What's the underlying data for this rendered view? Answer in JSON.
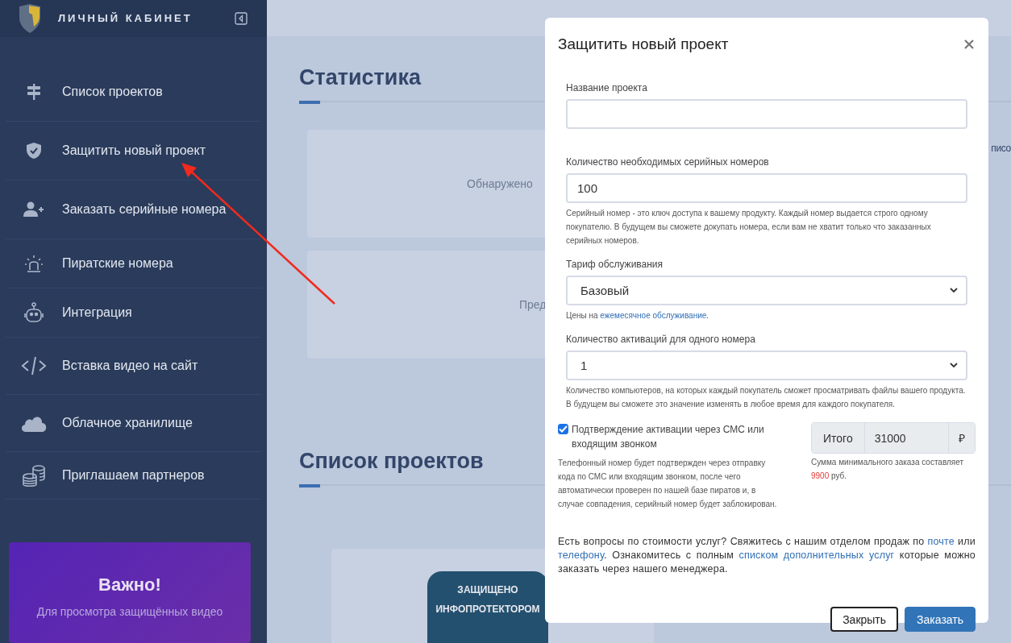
{
  "sidebar": {
    "brand": "ЛИЧНЫЙ КАБИНЕТ",
    "items": [
      {
        "label": "Список проектов"
      },
      {
        "label": "Защитить новый проект"
      },
      {
        "label": "Заказать серийные номера"
      },
      {
        "label": "Пиратские номера"
      },
      {
        "label": "Интеграция"
      },
      {
        "label": "Вставка видео на сайт"
      },
      {
        "label": "Облачное хранилище"
      },
      {
        "label": "Приглашаем партнеров"
      }
    ],
    "notice": {
      "title": "Важно!",
      "text": "Для просмотра защищённых видео"
    }
  },
  "page": {
    "stats_title": "Статистика",
    "stat_cards": [
      "Обнаружено",
      "Пред"
    ],
    "side_text": "писо",
    "projects_title": "Список проектов",
    "cover_text": [
      "ЗАЩИЩЕНО",
      "ИНФОПРОТЕКТОРОМ"
    ]
  },
  "modal": {
    "title": "Защитить новый проект",
    "fields": [
      {
        "kind": "text",
        "label": "Название проекта"
      },
      {
        "kind": "text",
        "label": "Количество необходимых серийных номеров",
        "value": "100",
        "help": [
          {
            "text": "Серийный номер - это ключ доступа к вашему продукту. Каждый номер выдается строго одному покупателю. В будущем вы сможете докупать номера, если вам не хватит только что заказанных серийных номеров.",
            "link": false
          }
        ]
      },
      {
        "kind": "select",
        "label": "Тариф обслуживания",
        "value": "Базовый",
        "help": [
          {
            "text": "Цены на ",
            "link": false
          },
          {
            "text": "ежемесячное обслуживание",
            "link": true
          },
          {
            "text": ".",
            "link": false
          }
        ]
      },
      {
        "kind": "select",
        "label": "Количество активаций для одного номера",
        "value": "1",
        "help": [
          {
            "text": "Количество компьютеров, на которых каждый покупатель сможет просматривать файлы вашего продукта. В будущем вы сможете это значение изменять в любое время для каждого покупателя.",
            "link": false
          }
        ]
      }
    ],
    "sms": {
      "checked": true,
      "label": "Подтверждение активации через СМС или входящим звонком",
      "help": "Телефонный номер будет подтвержден через отправку кода по СМС или входящим звонком, после чего автоматически проверен по нашей базе пиратов и, в случае совпадения, серийный номер будет заблокирован."
    },
    "total": {
      "label": "Итого",
      "value": "31000",
      "currency": "₽",
      "note_before": "Сумма минимального заказа составляет",
      "note_amount": "9900",
      "note_after": "руб."
    },
    "info": [
      {
        "text": "Есть вопросы по стоимости услуг? Свяжитесь с нашим отделом продаж по ",
        "link": false
      },
      {
        "text": "почте",
        "link": true
      },
      {
        "text": " или ",
        "link": false
      },
      {
        "text": "телефону",
        "link": true
      },
      {
        "text": ". Ознакомитесь с полным ",
        "link": false
      },
      {
        "text": "списком дополнительных услуг",
        "link": true
      },
      {
        "text": " которые можно заказать через нашего менеджера.",
        "link": false
      }
    ],
    "buttons": [
      {
        "label": "Закрыть",
        "kind": "secondary"
      },
      {
        "label": "Заказать",
        "kind": "primary"
      }
    ]
  }
}
